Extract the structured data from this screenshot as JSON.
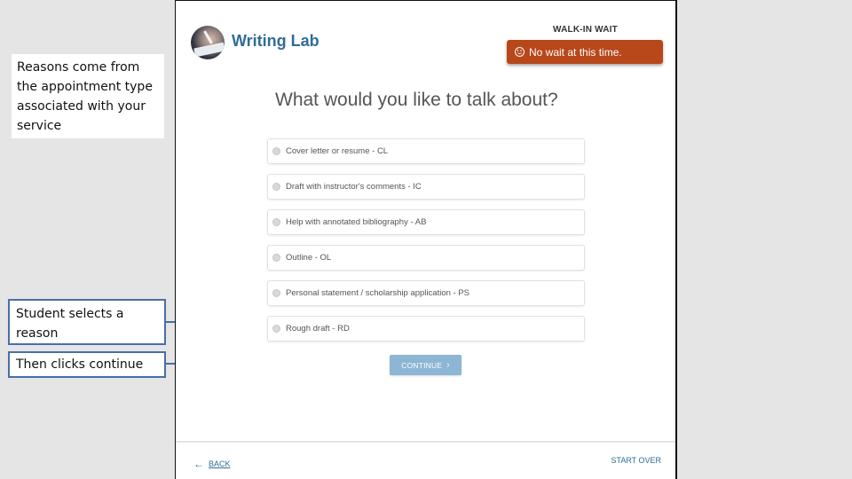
{
  "annotations": {
    "reasons_note": "Reasons come from the appointment type associated with your service",
    "select_note": "Student selects a reason",
    "continue_note": "Then clicks continue"
  },
  "header": {
    "app_title": "Writing Lab",
    "logo": "writing-hand-photo-icon",
    "wait_label": "WALK-IN WAIT",
    "wait_status": "No wait at this time.",
    "wait_icon": "smile-icon",
    "wait_color": "#b8471a"
  },
  "main": {
    "question": "What would you like to talk about?",
    "options": [
      {
        "label": "Cover letter or resume - CL",
        "selected": false
      },
      {
        "label": "Draft with instructor's comments - IC",
        "selected": false
      },
      {
        "label": "Help with annotated bibliography - AB",
        "selected": false
      },
      {
        "label": "Outline - OL",
        "selected": false
      },
      {
        "label": "Personal statement / scholarship application - PS",
        "selected": false
      },
      {
        "label": "Rough draft - RD",
        "selected": false
      }
    ],
    "continue_label": "CONTINUE",
    "continue_icon": "chevron-right-icon"
  },
  "footer": {
    "back_label": "BACK",
    "back_icon": "arrow-left-icon",
    "start_over_label": "START OVER"
  }
}
